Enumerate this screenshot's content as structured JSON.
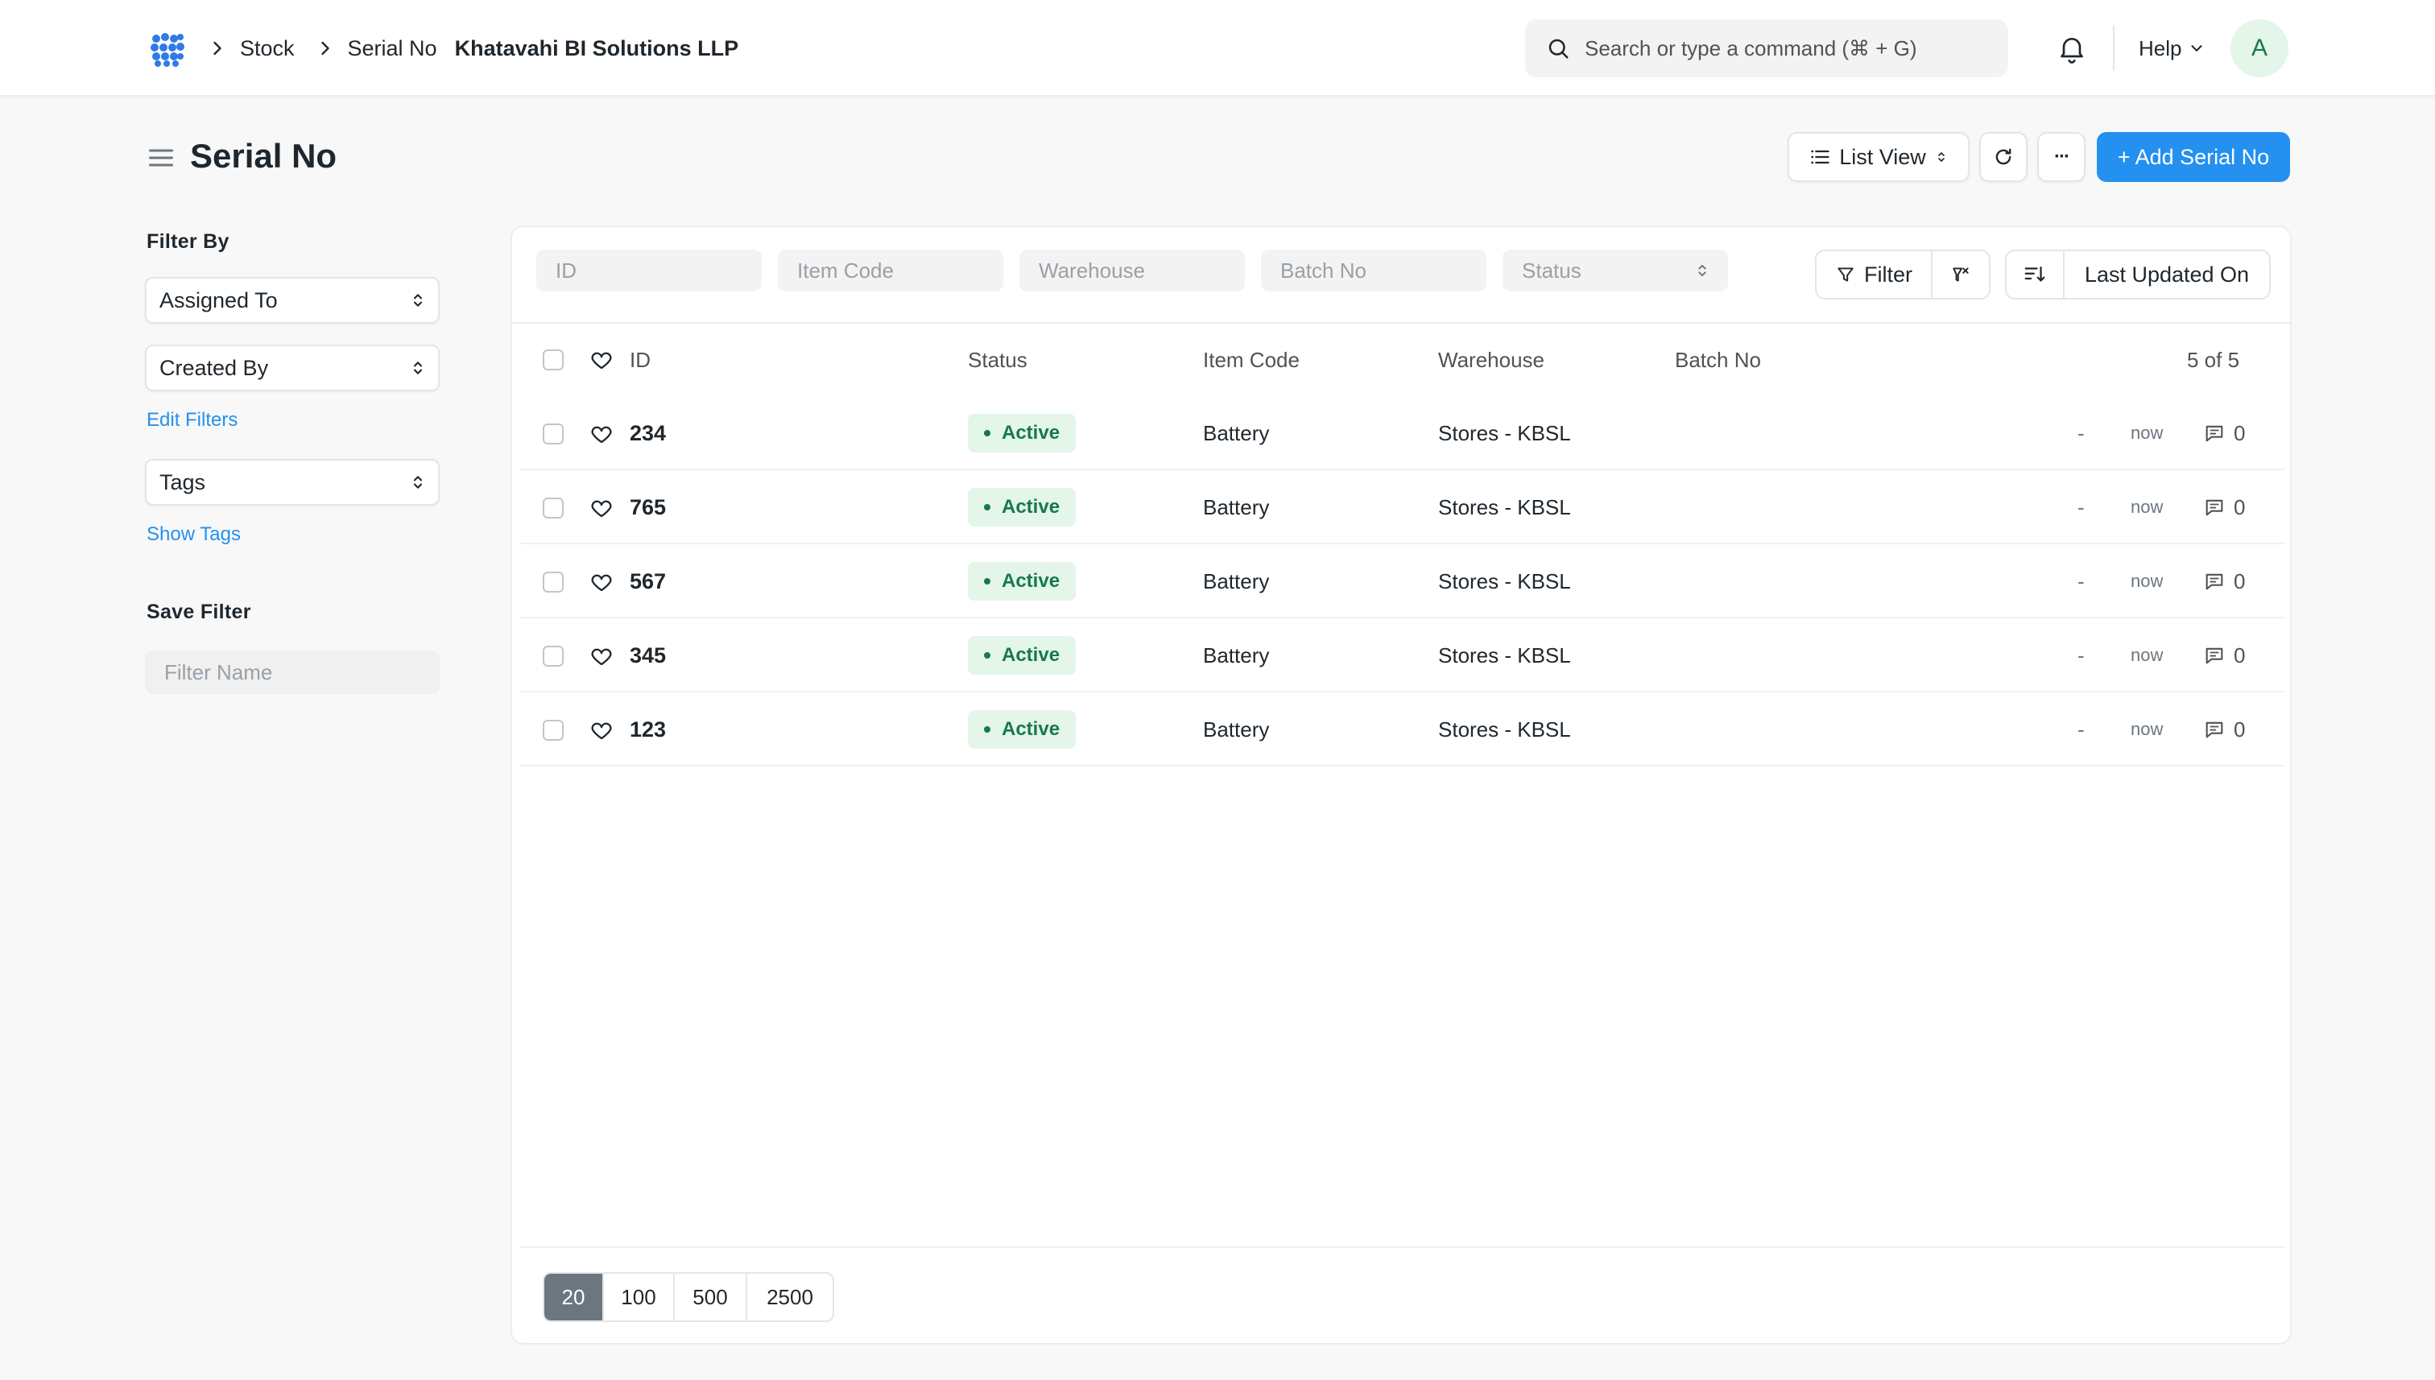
{
  "nav": {
    "breadcrumbs": [
      "Stock",
      "Serial No"
    ],
    "company": "Khatavahi BI Solutions LLP",
    "search_placeholder": "Search or type a command (⌘ + G)",
    "help_label": "Help",
    "avatar_initial": "A"
  },
  "page": {
    "title": "Serial No",
    "list_view_label": "List View",
    "more_label": "···",
    "add_label": "+ Add Serial No"
  },
  "sidebar": {
    "filter_by_label": "Filter By",
    "assigned_to": "Assigned To",
    "created_by": "Created By",
    "edit_filters": "Edit Filters",
    "tags": "Tags",
    "show_tags": "Show Tags",
    "save_filter_label": "Save Filter",
    "filter_name_placeholder": "Filter Name"
  },
  "filters": {
    "id": "ID",
    "item_code": "Item Code",
    "warehouse": "Warehouse",
    "batch_no": "Batch No",
    "status": "Status",
    "filter_label": "Filter",
    "sort_label": "Last Updated On"
  },
  "columns": {
    "id": "ID",
    "status": "Status",
    "item_code": "Item Code",
    "warehouse": "Warehouse",
    "batch_no": "Batch No",
    "count": "5 of 5"
  },
  "rows": [
    {
      "id": "234",
      "status": "Active",
      "item_code": "Battery",
      "warehouse": "Stores - KBSL",
      "dash": "-",
      "modified": "now",
      "comments": "0"
    },
    {
      "id": "765",
      "status": "Active",
      "item_code": "Battery",
      "warehouse": "Stores - KBSL",
      "dash": "-",
      "modified": "now",
      "comments": "0"
    },
    {
      "id": "567",
      "status": "Active",
      "item_code": "Battery",
      "warehouse": "Stores - KBSL",
      "dash": "-",
      "modified": "now",
      "comments": "0"
    },
    {
      "id": "345",
      "status": "Active",
      "item_code": "Battery",
      "warehouse": "Stores - KBSL",
      "dash": "-",
      "modified": "now",
      "comments": "0"
    },
    {
      "id": "123",
      "status": "Active",
      "item_code": "Battery",
      "warehouse": "Stores - KBSL",
      "dash": "-",
      "modified": "now",
      "comments": "0"
    }
  ],
  "paging": [
    "20",
    "100",
    "500",
    "2500"
  ],
  "colors": {
    "primary": "#2490ef",
    "success_bg": "#e4f5e9",
    "success_text": "#16794c"
  }
}
